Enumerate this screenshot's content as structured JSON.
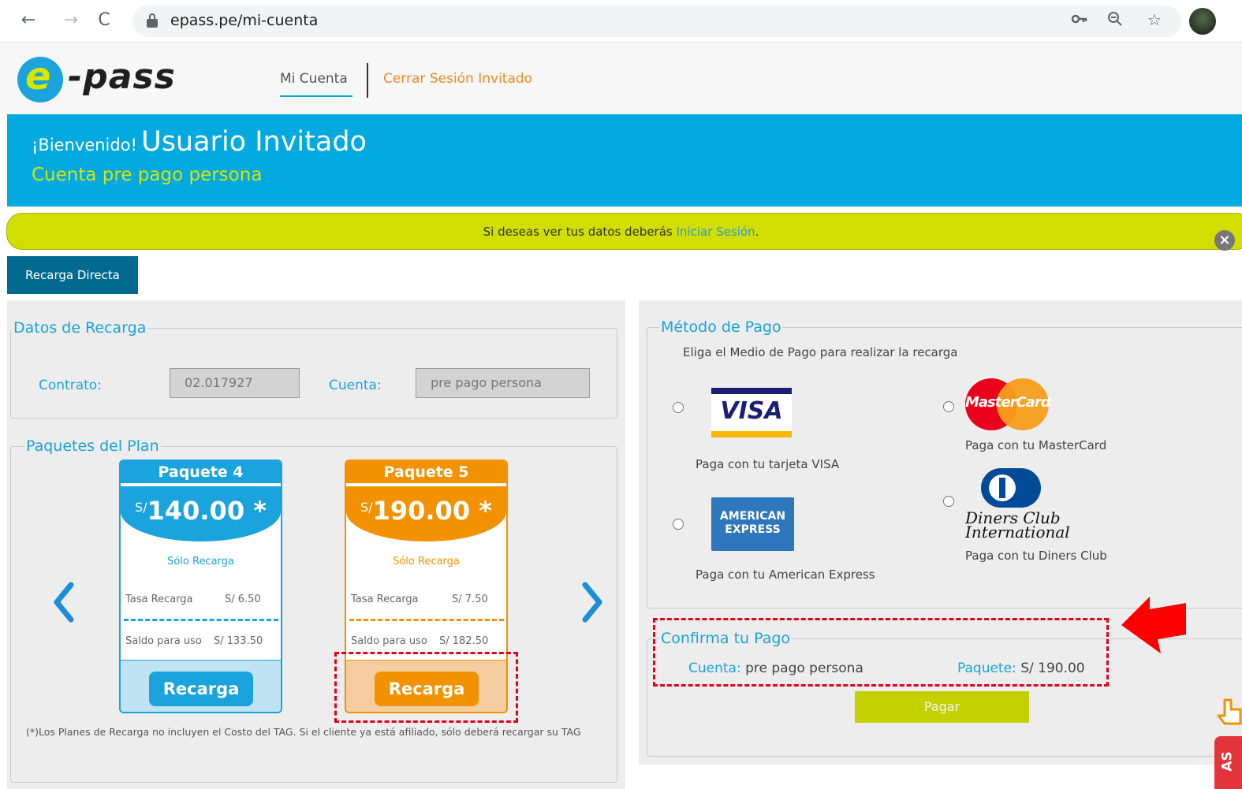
{
  "browser": {
    "url": "epass.pe/mi-cuenta"
  },
  "header": {
    "logo_e": "e",
    "logo_pass": "-pass",
    "nav_mi_cuenta": "Mi Cuenta",
    "nav_cerrar": "Cerrar Sesión Invitado"
  },
  "banner": {
    "welcome_small": "¡Bienvenido!",
    "welcome_name": "Usuario Invitado",
    "account_type": "Cuenta pre pago persona"
  },
  "infobar": {
    "text_before": "Si deseas ver tus datos deberás ",
    "link": "Iniciar Sesión",
    "text_after": "."
  },
  "tab": {
    "recarga_directa": "Recarga Directa"
  },
  "datos_recarga": {
    "legend": "Datos de Recarga",
    "contrato_label": "Contrato:",
    "contrato_value": "02.017927",
    "cuenta_label": "Cuenta:",
    "cuenta_value": "pre pago persona"
  },
  "paquetes": {
    "legend": "Paquetes del Plan",
    "items": [
      {
        "title": "Paquete 4",
        "currency": "S/",
        "amount": "140.00 *",
        "solo": "Sólo Recarga",
        "tasa_label": "Tasa Recarga",
        "tasa_value": "S/ 6.50",
        "saldo_label": "Saldo para uso",
        "saldo_value": "S/ 133.50",
        "button": "Recarga"
      },
      {
        "title": "Paquete 5",
        "currency": "S/",
        "amount": "190.00 *",
        "solo": "Sólo Recarga",
        "tasa_label": "Tasa Recarga",
        "tasa_value": "S/ 7.50",
        "saldo_label": "Saldo para uso",
        "saldo_value": "S/ 182.50",
        "button": "Recarga"
      }
    ],
    "footnote": "(*)Los Planes de Recarga no incluyen el Costo del TAG. Si el cliente ya está afiliado, sólo deberá recargar su TAG"
  },
  "metodo_pago": {
    "legend": "Método de Pago",
    "subtitle": "Eliga el Medio de Pago para realizar la recarga",
    "visa_logo": "VISA",
    "visa_caption": "Paga con tu tarjeta VISA",
    "mastercard_logo": "MasterCard",
    "mastercard_caption": "Paga con tu MasterCard",
    "amex_logo_line1": "AMERICAN",
    "amex_logo_line2": "EXPRESS",
    "amex_caption": "Paga con tu American Express",
    "diners_logo_line1": "Diners Club",
    "diners_logo_line2": "International",
    "diners_caption": "Paga con tu Diners Club"
  },
  "confirma": {
    "legend": "Confirma tu Pago",
    "cuenta_label": "Cuenta:",
    "cuenta_value": " pre pago persona",
    "paquete_label": "Paquete:",
    "paquete_value": " S/ 190.00",
    "pagar": "Pagar"
  },
  "side_tab": {
    "text": "AS"
  },
  "colors": {
    "brand_blue": "#03a9df",
    "brand_lime": "#d1de00",
    "orange": "#f39200",
    "highlight_red": "#e3001b"
  }
}
